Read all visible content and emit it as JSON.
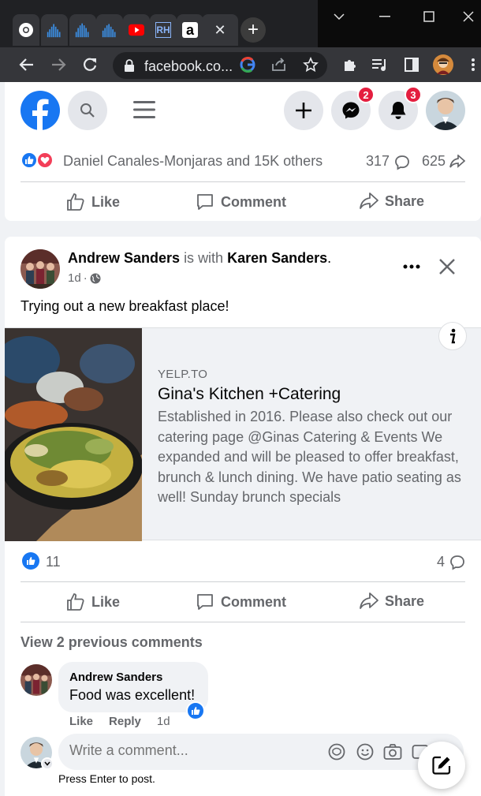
{
  "browser": {
    "url": "facebook.co...",
    "tabs": [
      {
        "icon": "chrome-icon"
      },
      {
        "icon": "audio-wave-icon"
      },
      {
        "icon": "audio-wave-icon"
      },
      {
        "icon": "audio-wave-icon"
      },
      {
        "icon": "youtube-icon"
      },
      {
        "icon": "rh-icon",
        "label": "RH"
      },
      {
        "icon": "amazon-icon",
        "label": "a"
      },
      {
        "icon": "close-icon",
        "label": "✕"
      }
    ],
    "new_tab": "+"
  },
  "header": {
    "messenger_badge": "2",
    "notifications_badge": "3"
  },
  "prev_post": {
    "reactions_text": "Daniel Canales-Monjaras and 15K others",
    "comments_count": "317",
    "shares_count": "625"
  },
  "actions": {
    "like": "Like",
    "comment": "Comment",
    "share": "Share"
  },
  "post": {
    "author": "Andrew Sanders",
    "with_text": "is with",
    "tagged": "Karen Sanders",
    "period": ".",
    "time": "1d",
    "dot": "·",
    "text": "Trying out a new breakfast place!",
    "link": {
      "domain": "YELP.TO",
      "title": "Gina's Kitchen +Catering",
      "description": "Established in 2016. Please also check out our catering page @Ginas Catering & Events We expanded and will be pleased to offer breakfast, brunch & lunch dining. We have patio seating as well! Sunday brunch specials"
    },
    "likes_count": "11",
    "comments_count": "4"
  },
  "comments": {
    "view_previous": "View 2 previous comments",
    "items": [
      {
        "author": "Andrew Sanders",
        "text": "Food was excellent!",
        "like": "Like",
        "reply": "Reply",
        "time": "1d"
      }
    ],
    "placeholder": "Write a comment...",
    "hint": "Press Enter to post."
  },
  "colors": {
    "fb_blue": "#1877f2",
    "badge_red": "#e41e3f"
  }
}
